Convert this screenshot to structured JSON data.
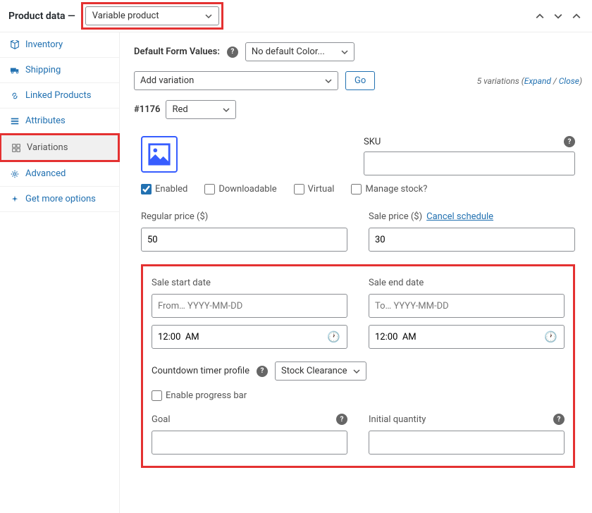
{
  "header": {
    "title": "Product data —",
    "dropdown": "Variable product"
  },
  "sidebar": {
    "items": [
      {
        "label": "Inventory"
      },
      {
        "label": "Shipping"
      },
      {
        "label": "Linked Products"
      },
      {
        "label": "Attributes"
      },
      {
        "label": "Variations"
      },
      {
        "label": "Advanced"
      },
      {
        "label": "Get more options"
      }
    ]
  },
  "content": {
    "default_form_label": "Default Form Values:",
    "default_form_select": "No default Color...",
    "add_variation": "Add variation",
    "go": "Go",
    "variations_count": "5 variations",
    "expand": "Expand",
    "close": "Close",
    "variation": {
      "id": "#1176",
      "attr": "Red",
      "sku_label": "SKU",
      "enabled": "Enabled",
      "downloadable": "Downloadable",
      "virtual": "Virtual",
      "manage_stock": "Manage stock?",
      "regular_price_label": "Regular price ($)",
      "regular_price": "50",
      "sale_price_label": "Sale price ($)",
      "sale_price": "30",
      "cancel_schedule": "Cancel schedule",
      "sale_start_label": "Sale start date",
      "sale_start_placeholder": "From… YYYY-MM-DD",
      "sale_end_label": "Sale end date",
      "sale_end_placeholder": "To… YYYY-MM-DD",
      "time": "12:00  AM",
      "countdown_label": "Countdown timer profile",
      "countdown_select": "Stock Clearance",
      "enable_progress": "Enable progress bar",
      "goal_label": "Goal",
      "initial_qty_label": "Initial quantity"
    }
  }
}
